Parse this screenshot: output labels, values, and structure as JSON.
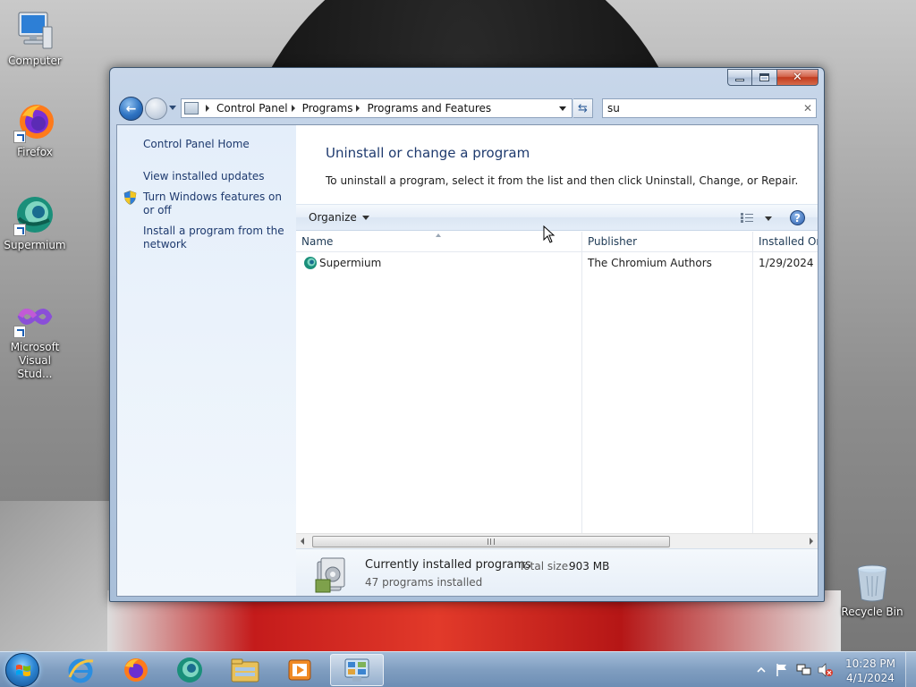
{
  "desktop": {
    "icons": [
      {
        "label": "Computer"
      },
      {
        "label": "Firefox"
      },
      {
        "label": "Supermium"
      },
      {
        "label": "Microsoft Visual Stud..."
      },
      {
        "label": "Recycle Bin"
      }
    ]
  },
  "window": {
    "address": {
      "crumbs": [
        "Control Panel",
        "Programs",
        "Programs and Features"
      ]
    },
    "search": {
      "value": "su"
    },
    "sidebar": {
      "home": "Control Panel Home",
      "updates": "View installed updates",
      "features": "Turn Windows features on or off",
      "network": "Install a program from the network"
    },
    "main": {
      "title": "Uninstall or change a program",
      "description": "To uninstall a program, select it from the list and then click Uninstall, Change, or Repair."
    },
    "toolbar": {
      "organize": "Organize",
      "help": "?"
    },
    "columns": {
      "name": "Name",
      "publisher": "Publisher",
      "installed_on": "Installed On"
    },
    "rows": [
      {
        "name": "Supermium",
        "publisher": "The Chromium Authors",
        "installed_on": "1/29/2024"
      }
    ],
    "details": {
      "title": "Currently installed programs",
      "total_size_label": "Total size:",
      "total_size": "903 MB",
      "count": "47 programs installed"
    }
  },
  "taskbar": {
    "time": "10:28 PM",
    "date": "4/1/2024"
  },
  "colors": {
    "link": "#1e3a6e",
    "accent": "#2e73c2"
  }
}
